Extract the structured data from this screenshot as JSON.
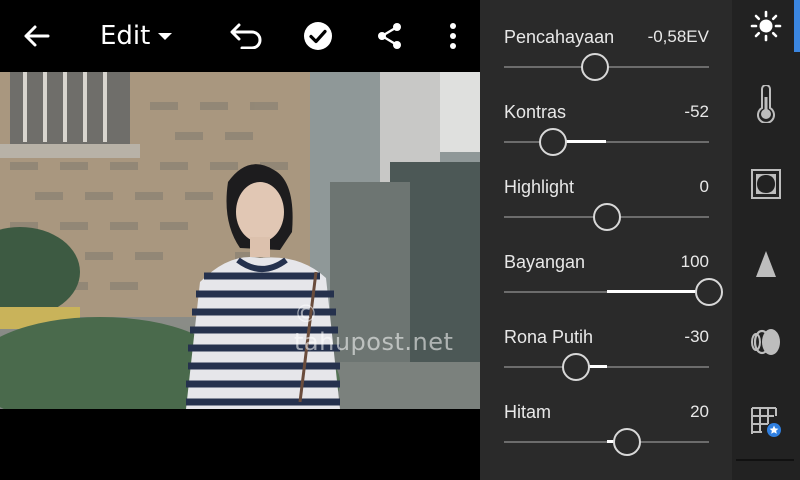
{
  "toolbar": {
    "mode_label": "Edit"
  },
  "photo": {
    "watermark": "© tahupost.net"
  },
  "adjustments": [
    {
      "label": "Pencahayaan",
      "value": "-0,58EV",
      "norm": -0.116
    },
    {
      "label": "Kontras",
      "value": "-52",
      "norm": -0.52
    },
    {
      "label": "Highlight",
      "value": "0",
      "norm": 0.0
    },
    {
      "label": "Bayangan",
      "value": "100",
      "norm": 1.0
    },
    {
      "label": "Rona Putih",
      "value": "-30",
      "norm": -0.3
    },
    {
      "label": "Hitam",
      "value": "20",
      "norm": 0.2
    }
  ],
  "rail": {
    "active_tool": "light-icon",
    "tools": [
      "light-icon",
      "color-temperature-icon",
      "effects-vignette-icon",
      "detail-sharpen-icon",
      "optics-lens-icon",
      "geometry-premium-icon"
    ]
  },
  "colors": {
    "panel_bg": "#2a2a2a",
    "rail_bg": "#222222",
    "accent": "#3b86e0",
    "slider_fill": "#ffffff"
  }
}
